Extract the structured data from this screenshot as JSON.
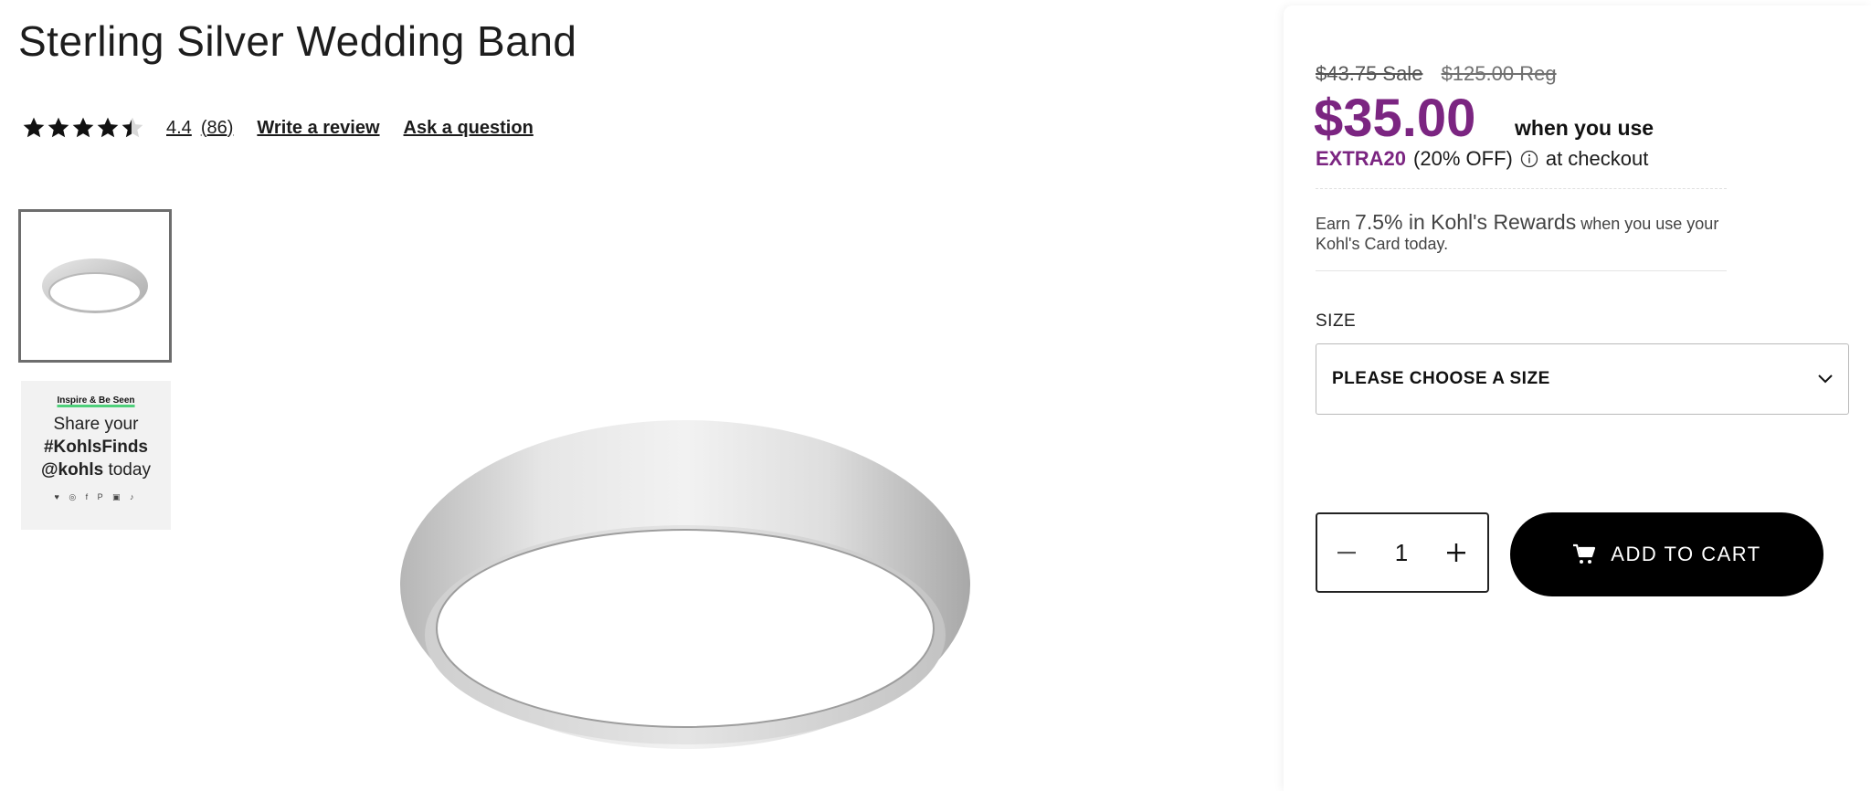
{
  "product": {
    "title": "Sterling Silver Wedding Band",
    "rating_value": "4.4",
    "review_count": "(86)",
    "rating_stars": 4.4,
    "write_review": "Write a review",
    "ask_question": "Ask a question"
  },
  "thumbnails": {
    "promo_small": "Inspire & Be Seen",
    "promo_line1": "Share your",
    "promo_hashtag": "#KohlsFinds",
    "promo_handle": "@kohls",
    "promo_today": " today",
    "promo_social": "♥ ◎ f P ▣ ♪"
  },
  "pricing": {
    "sale_price": "$43.75 Sale",
    "regular_price": "$125.00 Reg",
    "final_price": "$35.00",
    "when_you_use": "when you use",
    "promo_code": "EXTRA20",
    "promo_discount": "(20% OFF)",
    "at_checkout": "at checkout",
    "rewards_prefix": "Earn ",
    "rewards_highlight": "7.5% in Kohl's Rewards",
    "rewards_suffix": " when you use your Kohl's Card today."
  },
  "size": {
    "label": "SIZE",
    "selected": "PLEASE CHOOSE A SIZE"
  },
  "cart": {
    "quantity": "1",
    "add_label": "ADD TO CART"
  },
  "colors": {
    "brand_purple": "#7b2581",
    "button_black": "#000000"
  }
}
